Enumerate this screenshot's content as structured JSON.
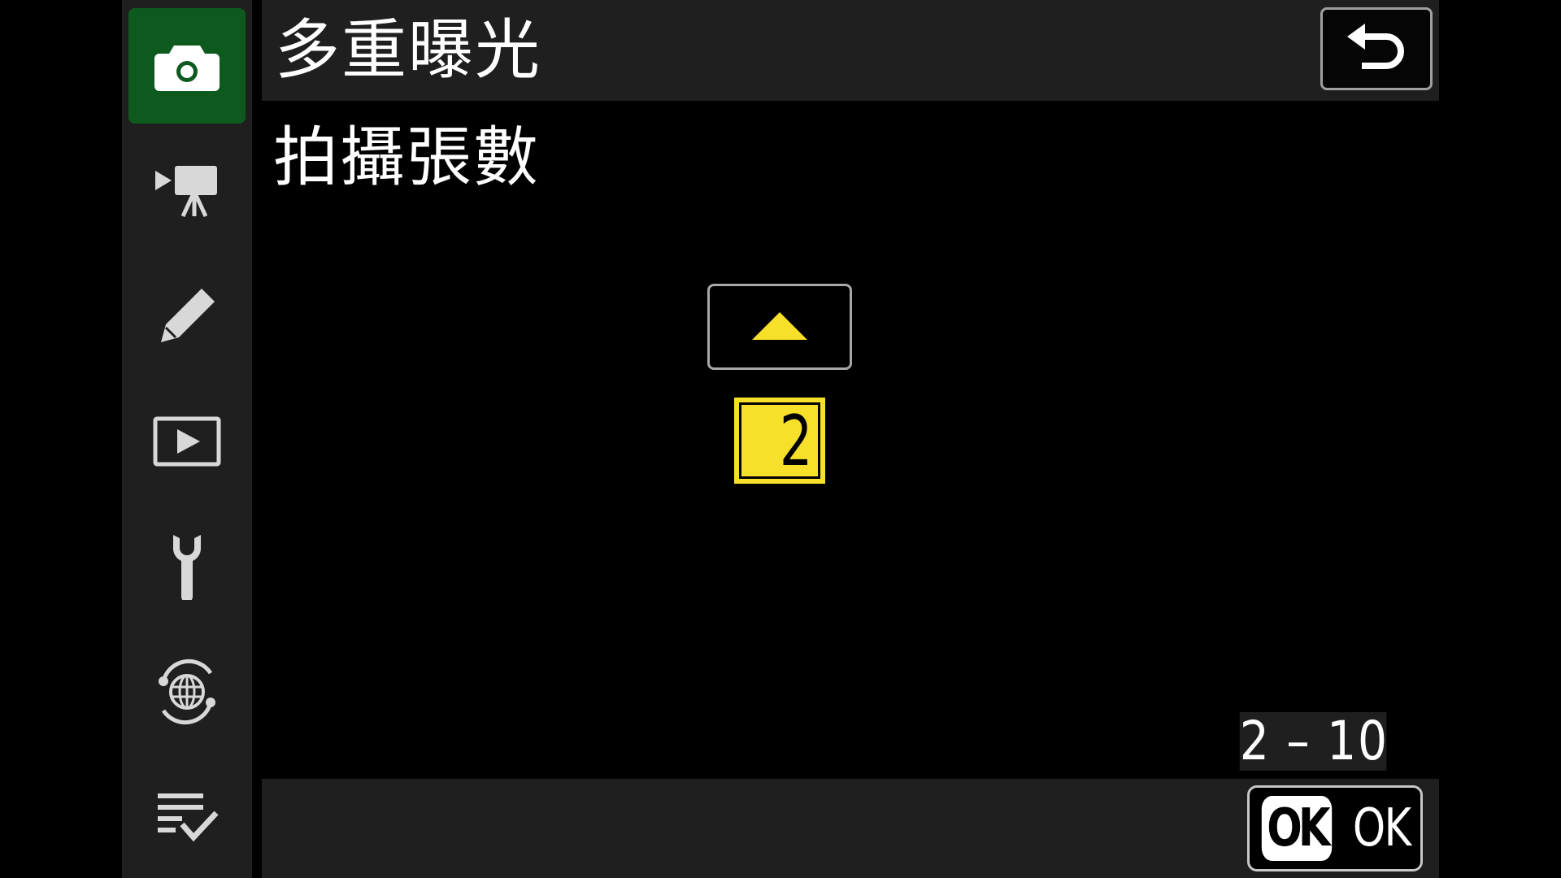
{
  "header": {
    "title": "多重曝光"
  },
  "content": {
    "setting_label": "拍攝張數",
    "current_value": "2",
    "range": "2 – 10"
  },
  "footer": {
    "ok_badge": "OK",
    "ok_label": "OK"
  },
  "sidebar": {
    "tabs": [
      {
        "icon": "camera-icon",
        "active": true
      },
      {
        "icon": "movie-camera-icon",
        "active": false
      },
      {
        "icon": "pencil-icon",
        "active": false
      },
      {
        "icon": "playback-icon",
        "active": false
      },
      {
        "icon": "wrench-icon",
        "active": false
      },
      {
        "icon": "network-icon",
        "active": false
      },
      {
        "icon": "my-menu-icon",
        "active": false
      }
    ]
  },
  "colors": {
    "active_tab": "#0e5a1e",
    "highlight": "#f7e02a",
    "panel": "#1f1f1f",
    "background": "#000000"
  }
}
